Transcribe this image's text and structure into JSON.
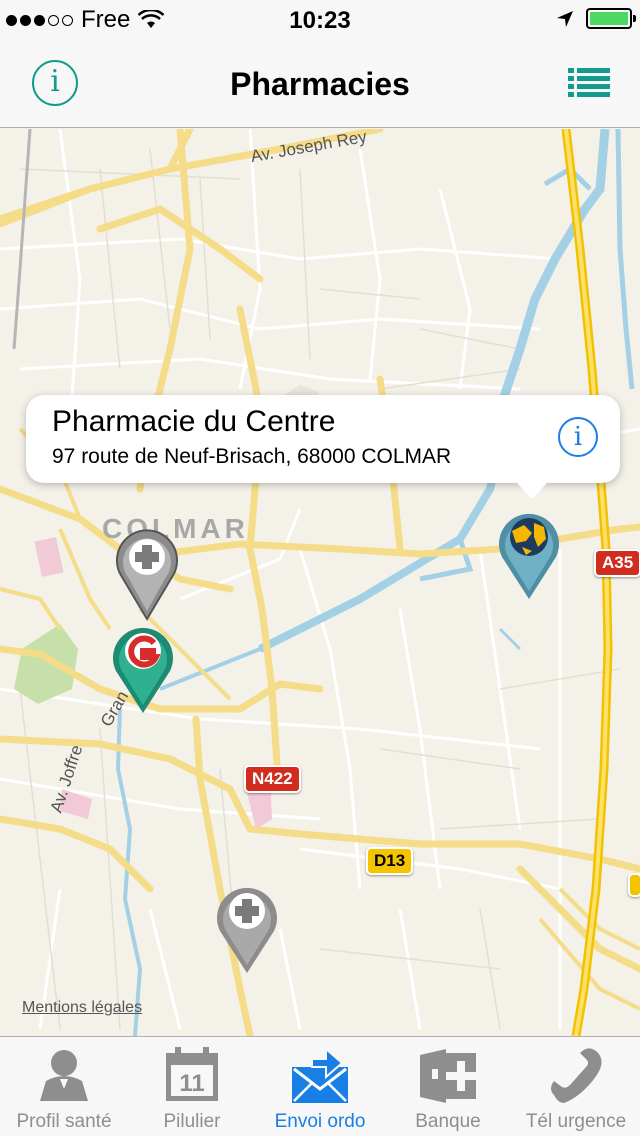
{
  "status_bar": {
    "carrier": "Free",
    "time": "10:23",
    "signal_bars_filled": 3,
    "signal_bars_total": 5,
    "battery_level": 1.0,
    "battery_color": "#4cd964"
  },
  "nav": {
    "title": "Pharmacies",
    "left_icon": "info-icon",
    "right_icon": "list-icon",
    "accent": "#139b8e"
  },
  "map": {
    "labels": {
      "road_joseph_rey": "Av. Joseph Rey",
      "city": "COLMAR",
      "road_grand": "Gran",
      "road_joffre": "Av. Joffre"
    },
    "shields": {
      "a35": "A35",
      "n422": "N422",
      "d13": "D13"
    },
    "legal_link": "Mentions légales"
  },
  "callout": {
    "title": "Pharmacie du Centre",
    "address": "97 route de Neuf-Brisach, 68000 COLMAR",
    "info_icon": "info-icon"
  },
  "pins": [
    {
      "name": "pharmacy-pin-gray",
      "icon": "cross-icon",
      "color": "#8c8c8c"
    },
    {
      "name": "pharmacy-pin-green",
      "icon": "g-logo-icon",
      "color": "#1f8a72"
    },
    {
      "name": "pharmacy-pin-gray",
      "icon": "cross-icon",
      "color": "#8c8c8c"
    },
    {
      "name": "pharmacy-pin-selected",
      "icon": "globe-icon",
      "color": "#4e8fa6"
    }
  ],
  "tabs": [
    {
      "label": "Profil santé",
      "icon": "person-icon",
      "active": false
    },
    {
      "label": "Pilulier",
      "icon": "calendar-icon",
      "active": false
    },
    {
      "label": "Envoi ordo",
      "icon": "mail-send-icon",
      "active": true
    },
    {
      "label": "Banque",
      "icon": "wallet-icon",
      "active": false
    },
    {
      "label": "Tél urgence",
      "icon": "phone-icon",
      "active": false
    }
  ]
}
